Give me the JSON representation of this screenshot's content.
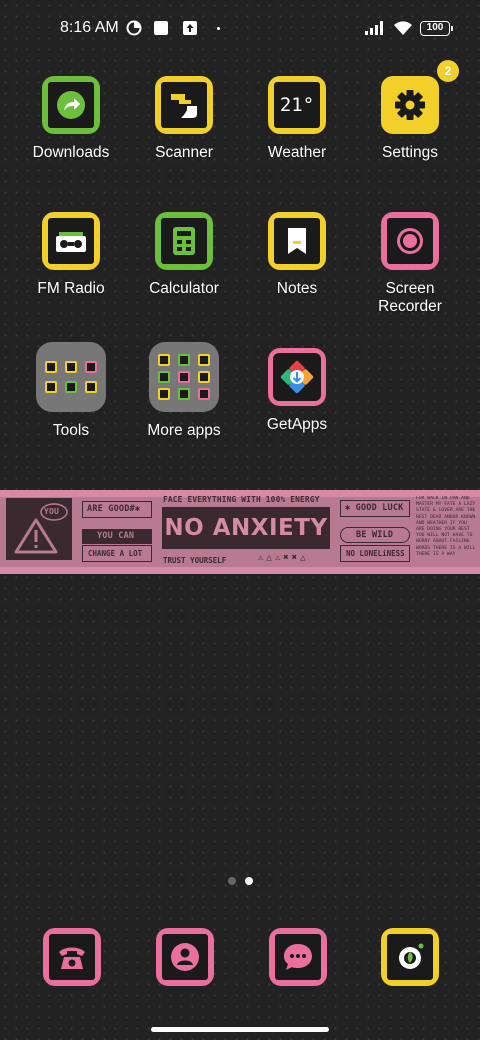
{
  "status_bar": {
    "time": "8:16 AM",
    "battery": "100",
    "icons": [
      "data-saver-icon",
      "notification-square-icon",
      "upload-icon",
      "signal-icon",
      "wifi-icon",
      "battery-icon"
    ]
  },
  "apps": [
    {
      "label": "Downloads",
      "icon": "share-arrow-icon",
      "frame": "green"
    },
    {
      "label": "Scanner",
      "icon": "scanner-icon",
      "frame": "yellow"
    },
    {
      "label": "Weather",
      "icon": "temperature-icon",
      "frame": "yellow",
      "text": "21°"
    },
    {
      "label": "Settings",
      "icon": "gear-icon",
      "frame": "yellow",
      "badge": "2"
    },
    {
      "label": "FM Radio",
      "icon": "radio-icon",
      "frame": "yellow"
    },
    {
      "label": "Calculator",
      "icon": "calculator-icon",
      "frame": "green"
    },
    {
      "label": "Notes",
      "icon": "note-icon",
      "frame": "yellow"
    },
    {
      "label": "Screen Recorder",
      "label_line1": "Screen",
      "label_line2": "Recorder",
      "icon": "record-icon",
      "frame": "pink"
    },
    {
      "label": "Tools",
      "icon": "folder-icon"
    },
    {
      "label": "More apps",
      "icon": "folder-icon"
    },
    {
      "label": "GetApps",
      "icon": "getapps-icon"
    }
  ],
  "banner": {
    "you": "YOU",
    "are_good": "ARE GOOD#✱",
    "you_can": "YOU CAN",
    "change_a_lot": "CHANGE A LOT",
    "top_line": "FACE EVERYTHING WITH 100% ENERGY",
    "headline": "NO ANXIETY",
    "trust": "TRUST YOURSELF",
    "good_luck": "✱ GOOD LUCK",
    "be_wild": "BE WILD",
    "no_loneliness": "NO LONELiNESS",
    "small_text": "FOR WALK IN PAN AND MASTER MY FATE A LAZY STATE & LOVER ARE THE BEST DEAR ANDOR KNOWN AND WEATHER IF YOU ARE DOING YOUR BEST YOU WILL NOT HAVE TO WORRY ABOUT FAILING WORDS THERE IS A WILL THERE IS A WAY"
  },
  "dock": [
    {
      "icon": "phone-icon",
      "frame": "pink"
    },
    {
      "icon": "contacts-icon",
      "frame": "pink"
    },
    {
      "icon": "messages-icon",
      "frame": "pink"
    },
    {
      "icon": "camera-icon",
      "frame": "yellow"
    }
  ],
  "pages": {
    "count": 2,
    "current": 2
  },
  "colors": {
    "green": "#6cbf3b",
    "yellow": "#f3cf2a",
    "pink": "#ea6f9c",
    "banner": "#d58aa5"
  }
}
